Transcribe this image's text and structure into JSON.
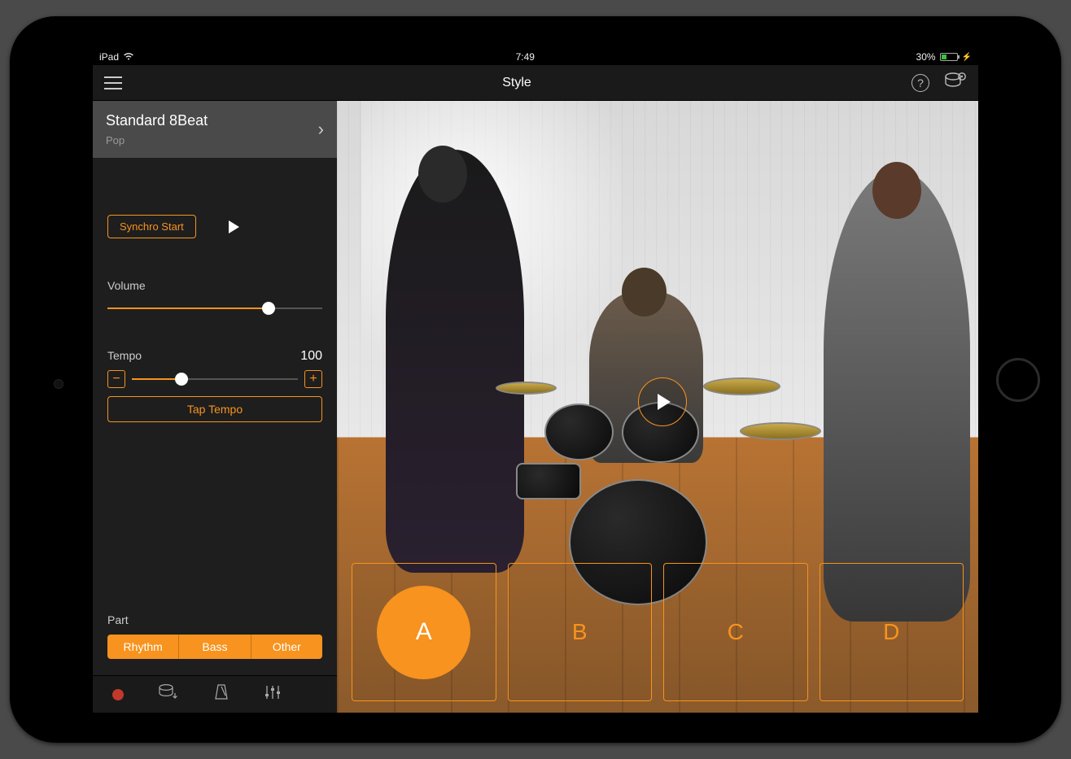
{
  "status": {
    "device": "iPad",
    "time": "7:49",
    "battery": "30%"
  },
  "nav": {
    "title": "Style"
  },
  "style": {
    "name": "Standard 8Beat",
    "genre": "Pop"
  },
  "controls": {
    "synchro_label": "Synchro Start",
    "volume_label": "Volume",
    "volume_percent": 75,
    "tempo_label": "Tempo",
    "tempo_value": "100",
    "tempo_percent": 30,
    "tap_tempo_label": "Tap Tempo",
    "part_label": "Part",
    "parts": [
      "Rhythm",
      "Bass",
      "Other"
    ]
  },
  "pads": [
    "A",
    "B",
    "C",
    "D"
  ],
  "active_pad": "A"
}
